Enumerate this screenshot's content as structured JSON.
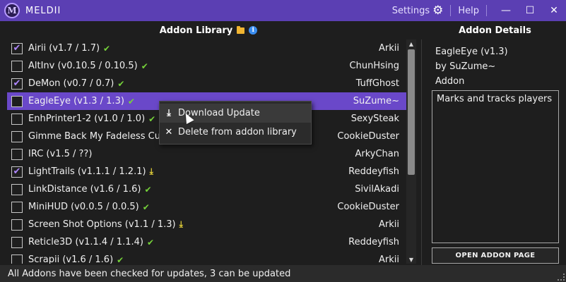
{
  "app": {
    "title": "MELDII",
    "logo_letter": "M"
  },
  "titlebar": {
    "settings_label": "Settings",
    "help_label": "Help",
    "minimize": "—",
    "maximize": "☐",
    "close": "✕"
  },
  "library": {
    "header": "Addon Library",
    "rows": [
      {
        "name": "Airii (v1.7 / 1.7)",
        "author": "Arkii",
        "checked": true,
        "status": "✔"
      },
      {
        "name": "AltInv (v0.10.5 / 0.10.5)",
        "author": "ChunHsing",
        "checked": false,
        "status": "✔"
      },
      {
        "name": "DeMon (v0.7 / 0.7)",
        "author": "TuffGhost",
        "checked": true,
        "status": "✔"
      },
      {
        "name": "EagleEye (v1.3 / 1.3)",
        "author": "SuZume~",
        "checked": false,
        "status": "✔",
        "selected": true
      },
      {
        "name": "EnhPrinter1-2 (v1.0 / 1.0)",
        "author": "SexySteak",
        "checked": false,
        "status": "✔"
      },
      {
        "name": "Gimme Back My Fadeless Curs",
        "author": "CookieDuster",
        "checked": false,
        "status": ""
      },
      {
        "name": "IRC (v1.5 / ??)",
        "author": "ArkyChan",
        "checked": false,
        "status": ""
      },
      {
        "name": "LightTrails (v1.1.1 / 1.2.1)",
        "author": "Reddeyfish",
        "checked": true,
        "status": "⤓"
      },
      {
        "name": "LinkDistance (v1.6 / 1.6)",
        "author": "SivilAkadi",
        "checked": false,
        "status": "✔"
      },
      {
        "name": "MiniHUD (v0.0.5 / 0.0.5)",
        "author": "CookieDuster",
        "checked": false,
        "status": "✔"
      },
      {
        "name": "Screen Shot Options (v1.1 / 1.3)",
        "author": "Arkii",
        "checked": false,
        "status": "⤓"
      },
      {
        "name": "Reticle3D (v1.1.4 / 1.1.4)",
        "author": "Reddeyfish",
        "checked": false,
        "status": "✔"
      },
      {
        "name": "Scrapii (v1.6 / 1.6)",
        "author": "Arkii",
        "checked": false,
        "status": "✔"
      }
    ]
  },
  "context_menu": {
    "items": [
      {
        "icon": "⤓",
        "label": "Download Update"
      },
      {
        "icon": "✕",
        "label": "Delete from addon library"
      }
    ]
  },
  "details": {
    "header": "Addon Details",
    "name": "EagleEye (v1.3)",
    "author": "by SuZume~",
    "type": "Addon",
    "description": "Marks and tracks players",
    "open_button": "OPEN ADDON PAGE"
  },
  "statusbar": {
    "text": "All Addons have been checked for updates, 3 can be updated"
  },
  "colors": {
    "accent": "#5b3fb3",
    "selected_row": "#6a48c9",
    "ok": "#76d33a",
    "update": "#e8d43a"
  }
}
